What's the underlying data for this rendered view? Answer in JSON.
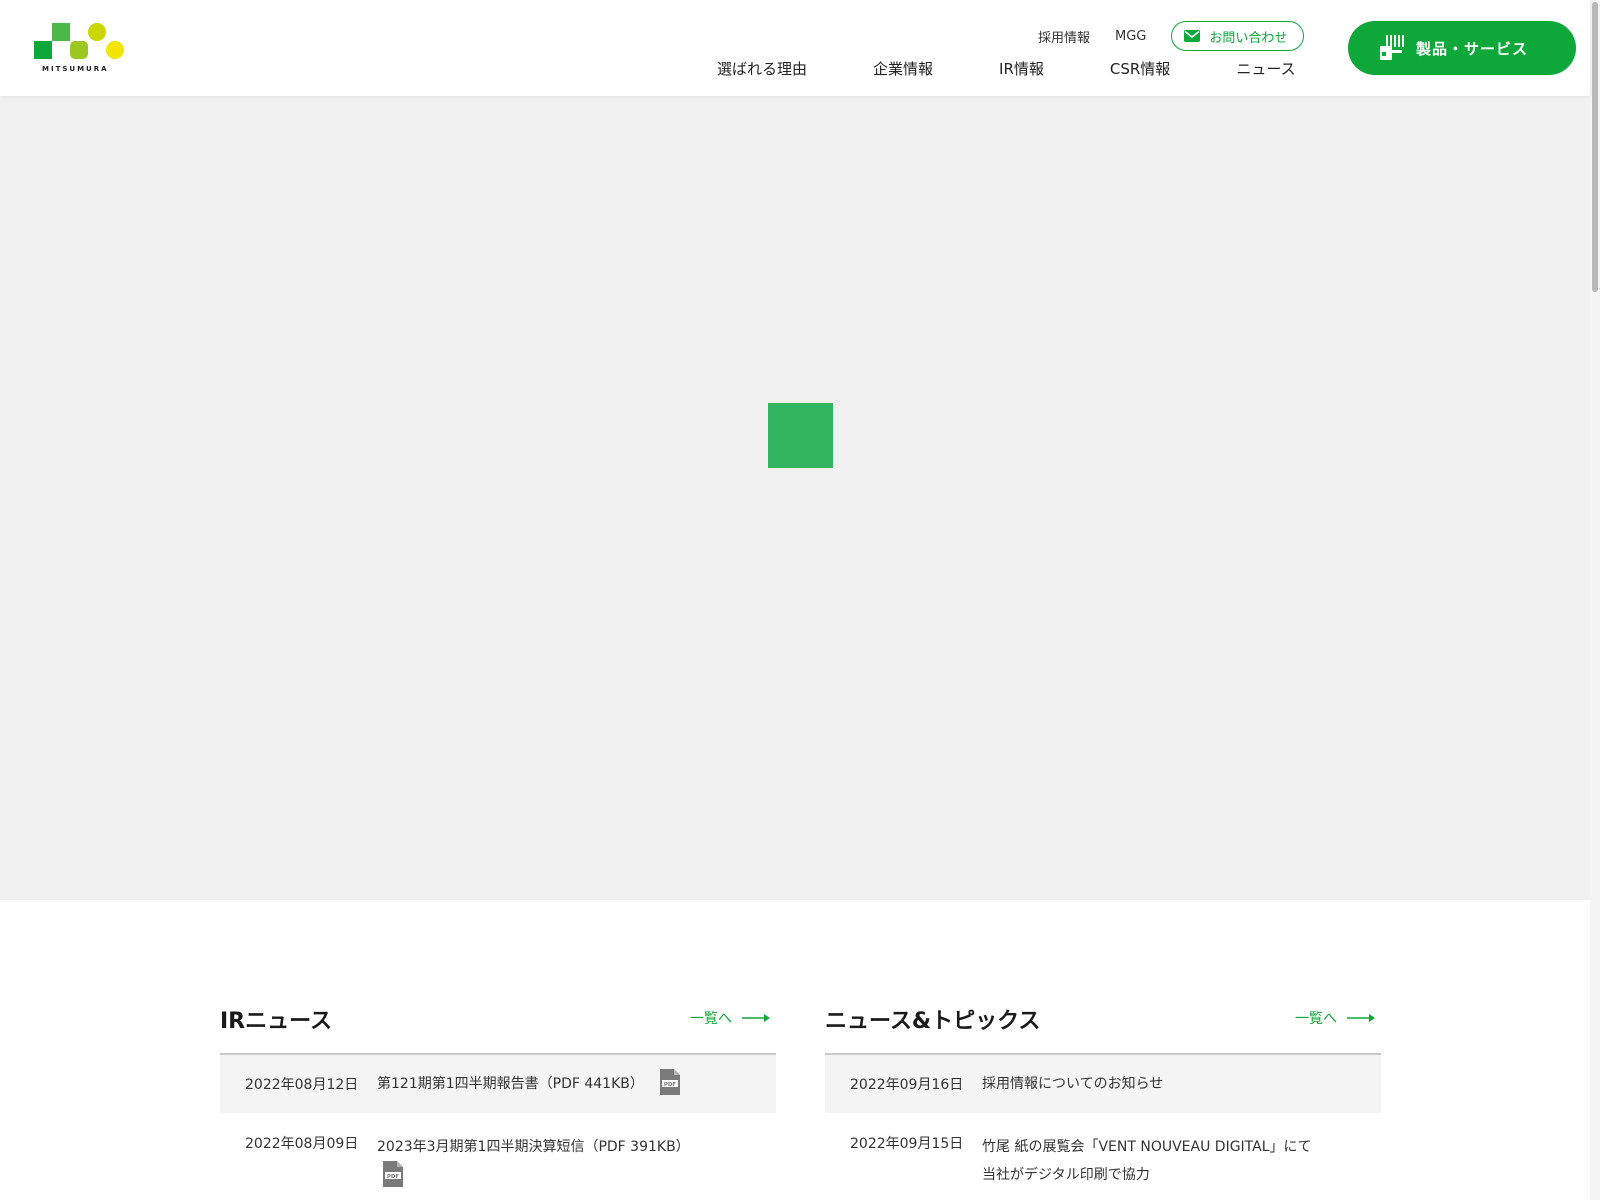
{
  "header": {
    "logo_text": "MITSUMURA",
    "util_links": [
      "採用情報",
      "MGG"
    ],
    "contact_label": "お問い合わせ",
    "main_nav": [
      "選ばれる理由",
      "企業情報",
      "IR情報",
      "CSR情報",
      "ニュース"
    ],
    "products_label": "製品・サービス"
  },
  "colors": {
    "brand_green": "#0ea83a",
    "loader_green": "#31b560",
    "hero_bg": "#eff0ef"
  },
  "ir_news": {
    "title": "IRニュース",
    "more_label": "一覧へ",
    "items": [
      {
        "date": "2022年08月12日",
        "text": "第121期第1四半期報告書（PDF 441KB）",
        "icon": "pdf-icon"
      },
      {
        "date": "2022年08月09日",
        "text": "2023年3月期第1四半期決算短信（PDF 391KB）",
        "icon": "pdf-icon"
      }
    ]
  },
  "topics_news": {
    "title": "ニュース&トピックス",
    "more_label": "一覧へ",
    "items": [
      {
        "date": "2022年09月16日",
        "text": "採用情報についてのお知らせ"
      },
      {
        "date": "2022年09月15日",
        "text": "竹尾 紙の展覧会「VENT NOUVEAU DIGITAL」にて当社がデジタル印刷で協力"
      }
    ]
  }
}
